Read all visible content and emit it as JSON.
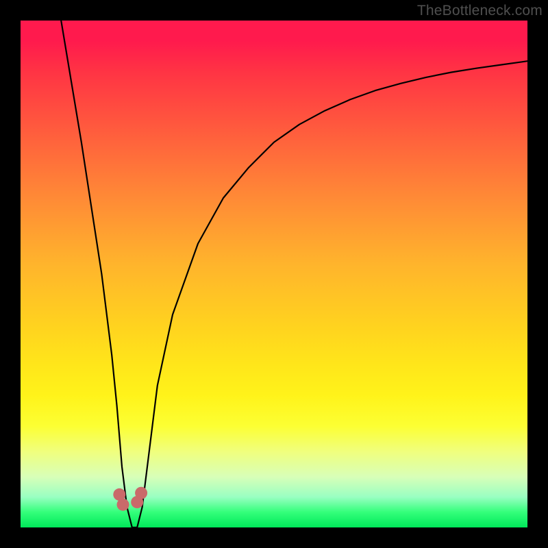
{
  "watermark": "TheBottleneck.com",
  "chart_data": {
    "type": "line",
    "title": "",
    "xlabel": "",
    "ylabel": "",
    "xlim": [
      0,
      100
    ],
    "ylim": [
      0,
      100
    ],
    "series": [
      {
        "name": "bottleneck-curve",
        "x": [
          8,
          10,
          12,
          14,
          16,
          18,
          19,
          20,
          21,
          22,
          23,
          24,
          25,
          27,
          30,
          35,
          40,
          45,
          50,
          55,
          60,
          65,
          70,
          75,
          80,
          85,
          90,
          95,
          100
        ],
        "y": [
          100,
          88,
          76,
          63,
          50,
          34,
          24,
          12,
          4,
          0,
          0,
          4,
          12,
          28,
          42,
          56,
          65,
          71,
          76,
          79.5,
          82.2,
          84.4,
          86.2,
          87.6,
          88.8,
          89.8,
          90.6,
          91.3,
          92
        ]
      }
    ],
    "markers": [
      {
        "name": "dot-a",
        "x": 19.5,
        "y": 6.5
      },
      {
        "name": "dot-b",
        "x": 20.2,
        "y": 4.5
      },
      {
        "name": "dot-c",
        "x": 23.0,
        "y": 5.0
      },
      {
        "name": "dot-d",
        "x": 23.8,
        "y": 6.8
      }
    ],
    "background_gradient": {
      "top": "#ff1a4d",
      "middle": "#ffe61a",
      "bottom": "#00e85a"
    }
  }
}
